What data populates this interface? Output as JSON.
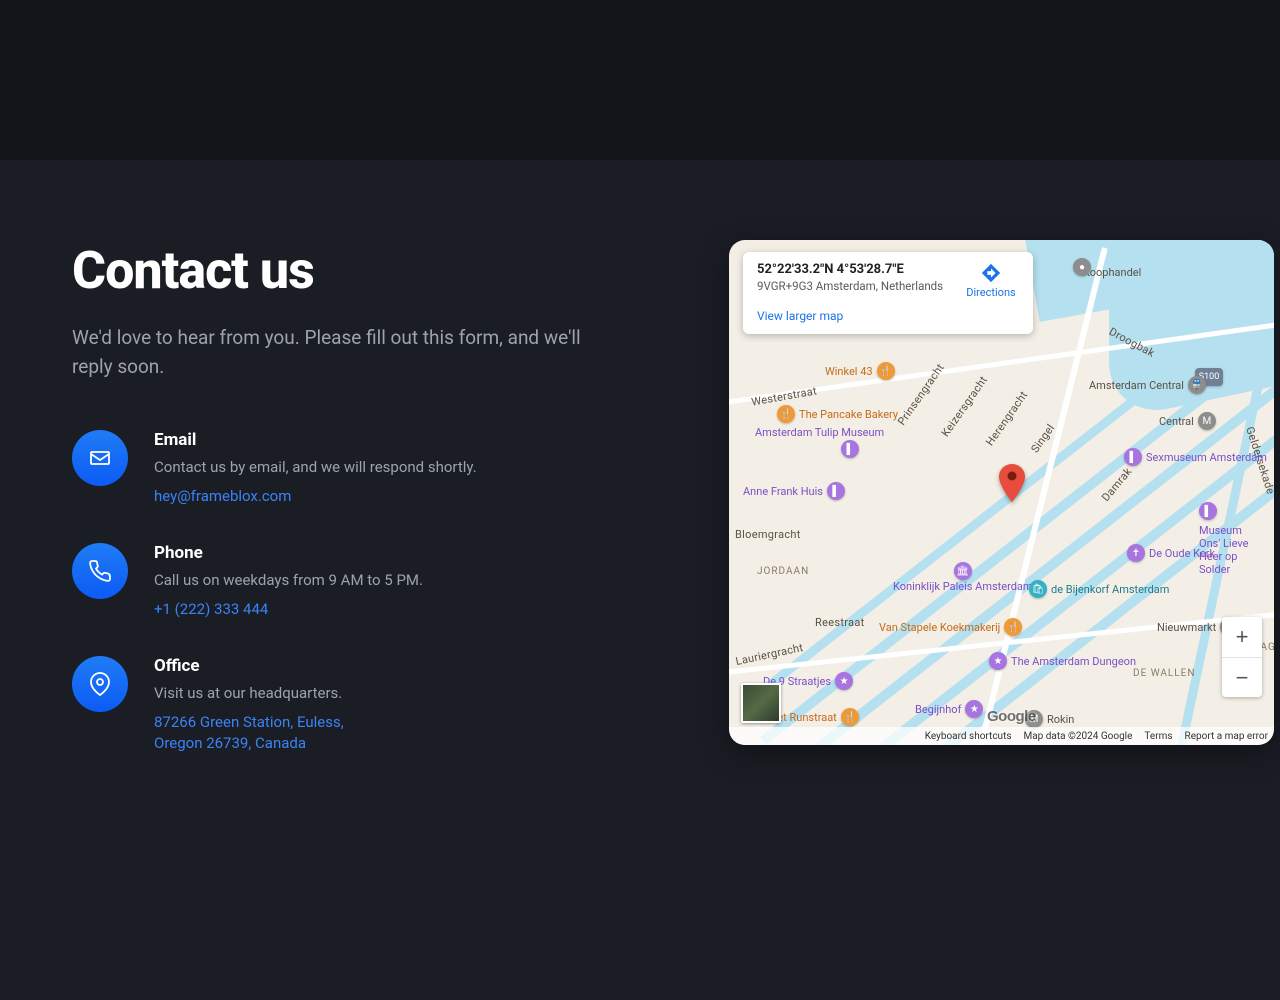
{
  "heading": "Contact us",
  "subtitle": "We'd love to hear from you. Please fill out this form, and we'll reply soon.",
  "contacts": {
    "email": {
      "title": "Email",
      "desc": "Contact us by email, and we will respond shortly.",
      "link": "hey@frameblox.com"
    },
    "phone": {
      "title": "Phone",
      "desc": "Call us on weekdays from 9 AM to 5 PM.",
      "link": "+1 (222) 333 444"
    },
    "office": {
      "title": "Office",
      "desc": "Visit us at our headquarters.",
      "link": "87266 Green Station, Euless, Oregon 26739, Canada"
    }
  },
  "map": {
    "coords": "52°22'33.2\"N 4°53'28.7\"E",
    "address": "9VGR+9G3 Amsterdam, Netherlands",
    "directions": "Directions",
    "view_larger": "View larger map",
    "zoom_in": "+",
    "zoom_out": "−",
    "logo": "Google",
    "footer": {
      "shortcuts": "Keyboard shortcuts",
      "data": "Map data ©2024 Google",
      "terms": "Terms",
      "report": "Report a map error"
    },
    "labels": {
      "koophandel": "Koophandel",
      "winkel43": "Winkel 43",
      "pancake": "The Pancake Bakery",
      "tulip": "Amsterdam Tulip Museum",
      "annefrank": "Anne Frank Huis",
      "bloemgracht": "Bloemgracht",
      "jordaan": "JORDAAN",
      "lastag": "LASTAG",
      "dewallen": "DE WALLEN",
      "westerstraat": "Westerstraat",
      "prinsengracht": "Prinsengracht",
      "keizersgracht": "Keizersgracht",
      "herengracht": "Herengracht",
      "singel": "Singel",
      "damrak": "Damrak",
      "centralm": "Central",
      "amscentral": "Amsterdam Central",
      "sexmuseum": "Sexmuseum Amsterdam",
      "oudekerk": "De Oude Kerk",
      "onslieve": "Museum Ons' Lieve Heer op Solder",
      "koninklijk": "Koninklijk Paleis Amsterdam",
      "bijenkorf": "de Bijenkorf Amsterdam",
      "nieuwmarkt": "Nieuwmarkt",
      "stapele": "Van Stapele Koekmakerij",
      "dungeon": "The Amsterdam Dungeon",
      "straatjes": "De 9 Straatjes",
      "begijnhof": "Begijnhof",
      "runstraat": "Friet Runstraat",
      "reestraat": "Reestraat",
      "lauriergracht": "Lauriergracht",
      "rokin": "Rokin",
      "geldersekade": "Geldersekade",
      "droogbak": "Droogbak",
      "s100": "S100"
    }
  }
}
